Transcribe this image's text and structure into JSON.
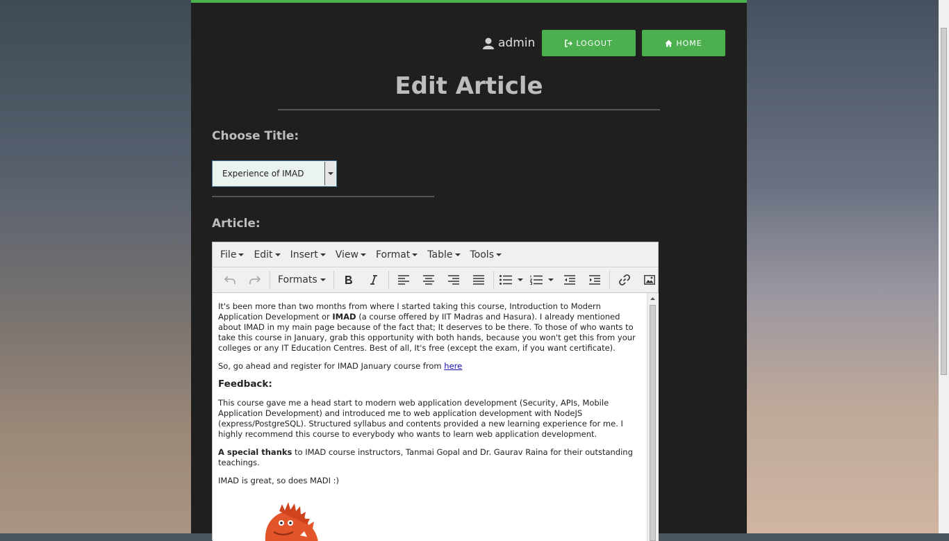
{
  "header": {
    "username": "admin",
    "logout_label": "LOGOUT",
    "home_label": "HOME",
    "accent_color": "#4caf50"
  },
  "page": {
    "title": "Edit Article",
    "choose_title_label": "Choose Title:",
    "selected_title": "Experience of IMAD",
    "article_label": "Article:"
  },
  "editor": {
    "menus": [
      "File",
      "Edit",
      "Insert",
      "View",
      "Format",
      "Table",
      "Tools"
    ],
    "formats_label": "Formats",
    "content": {
      "p1_a": "It's been more than two months from where I started taking this course, Introduction to Modern Application Development or ",
      "p1_bold": "IMAD",
      "p1_b": " (a course offered by IIT Madras and Hasura). I already mentioned about IMAD in my main page because of the fact that; It deserves to be there. To those of who wants to take this course in January, grab this opportunity with both hands, because you won't get this from your colleges or any IT Education Centres. Best of all, It's free (except the exam, if you want certificate).",
      "p2_a": "So, go ahead and register for IMAD January course from ",
      "p2_link": "here",
      "heading": "Feedback:",
      "p3": "This course gave me a head start to modern web application development (Security, APIs, Mobile Application Development) and introduced me to web application development with NodeJS (express/PostgreSQL). Structured syllabus and contents provided a new learning experience for me. I highly recommend this course to everybody who wants to learn web application development.",
      "p4_bold": "A special thanks",
      "p4_rest": " to IMAD course instructors, Tanmai Gopal and Dr. Gaurav Raina for their outstanding teachings.",
      "p5": "IMAD is great, so does MADI :)"
    }
  }
}
